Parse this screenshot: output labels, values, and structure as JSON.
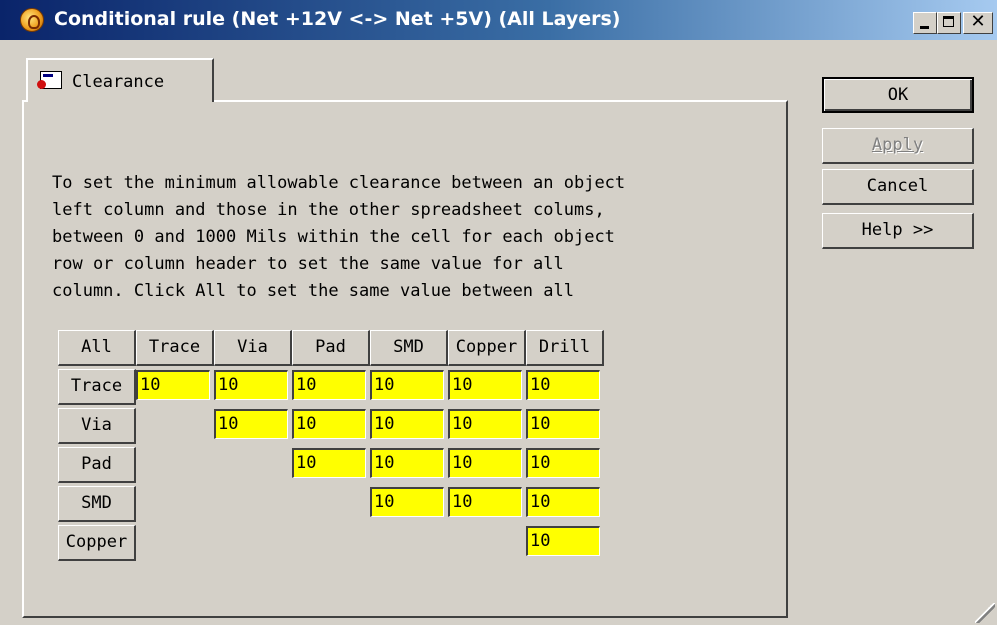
{
  "window": {
    "title": "Conditional rule (Net +12V <-> Net +5V) (All Layers)",
    "icon": "app-logo-icon",
    "controls": {
      "minimize": "minimize-icon",
      "maximize": "maximize-icon",
      "close": "✕"
    }
  },
  "tab": {
    "label": "Clearance",
    "icon": "clearance-tab-icon"
  },
  "description": "To set the minimum allowable clearance between an object\nleft column and those in the other spreadsheet colums,\nbetween 0 and 1000 Mils within the cell for each object\nrow or column header to set the same value for all\ncolumn. Click All to set the same value between all",
  "grid": {
    "all_label": "All",
    "columns": [
      "Trace",
      "Via",
      "Pad",
      "SMD",
      "Copper",
      "Drill"
    ],
    "rows": [
      {
        "label": "Trace",
        "values": [
          "10",
          "10",
          "10",
          "10",
          "10",
          "10"
        ]
      },
      {
        "label": "Via",
        "values": [
          "10",
          "10",
          "10",
          "10",
          "10"
        ]
      },
      {
        "label": "Pad",
        "values": [
          "10",
          "10",
          "10",
          "10"
        ]
      },
      {
        "label": "SMD",
        "values": [
          "10",
          "10",
          "10"
        ]
      },
      {
        "label": "Copper",
        "values": [
          "10"
        ]
      }
    ]
  },
  "buttons": {
    "ok": "OK",
    "apply": "Apply",
    "cancel": "Cancel",
    "help": "Help >>"
  },
  "colors": {
    "title_start": "#0a246a",
    "title_end": "#a6caf0",
    "cell_fill": "#ffff00",
    "face": "#d4d0c8"
  }
}
